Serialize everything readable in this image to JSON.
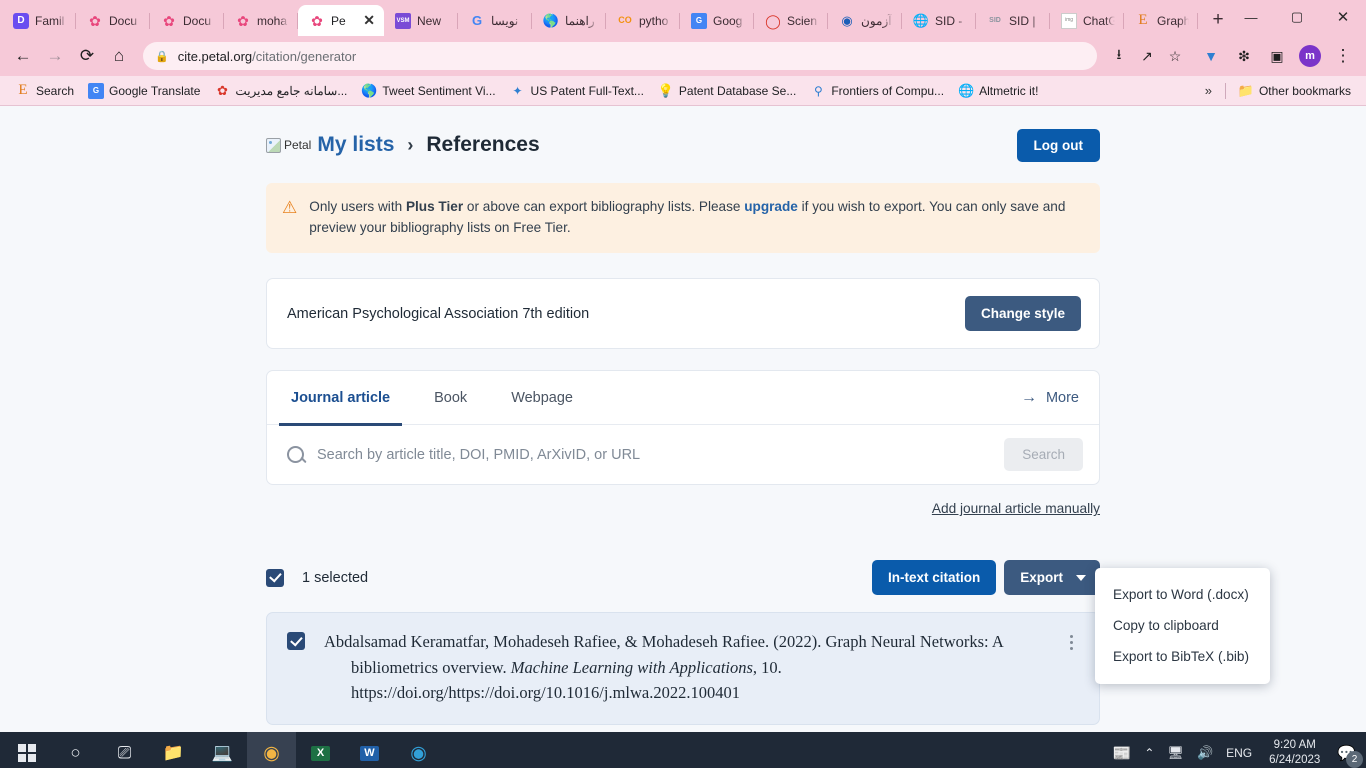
{
  "browser": {
    "tabs": [
      {
        "title": "Famil",
        "icon": "D",
        "icon_color": "#6a4df0",
        "active": false
      },
      {
        "title": "Docu",
        "icon": "flower",
        "icon_color": "#e8467c",
        "active": false
      },
      {
        "title": "Docu",
        "icon": "flower",
        "icon_color": "#e8467c",
        "active": false
      },
      {
        "title": "moha",
        "icon": "flower",
        "icon_color": "#e8467c",
        "active": false
      },
      {
        "title": "Pe",
        "icon": "flower",
        "icon_color": "#e8467c",
        "active": true
      },
      {
        "title": "New",
        "icon": "VSM",
        "icon_color": "#7a4bd6",
        "active": false
      },
      {
        "title": "نویسا",
        "icon": "G",
        "icon_color": "#4285f4",
        "active": false
      },
      {
        "title": "راهنما",
        "icon": "globe",
        "icon_color": "#2c3e50",
        "active": false
      },
      {
        "title": "pytho",
        "icon": "CO",
        "icon_color": "#f29111",
        "active": false
      },
      {
        "title": "Goog",
        "icon": "Gt",
        "icon_color": "#4285f4",
        "active": false
      },
      {
        "title": "Scien",
        "icon": "speech",
        "icon_color": "#d9372b",
        "active": false
      },
      {
        "title": "آزمون",
        "icon": "globe2",
        "icon_color": "#1a5eb8",
        "active": false
      },
      {
        "title": "SID -",
        "icon": "globe3",
        "icon_color": "#3a5566",
        "active": false
      },
      {
        "title": "SID |",
        "icon": "SID",
        "icon_color": "#8b949e",
        "active": false
      },
      {
        "title": "ChatG",
        "icon": "img",
        "icon_color": "#9aa0a6",
        "active": false
      },
      {
        "title": "Graph",
        "icon": "E",
        "icon_color": "#e07b1a",
        "active": false
      }
    ],
    "new_tab_label": "+",
    "tab_close_label": "✕",
    "window_controls": {
      "minimize": "—",
      "maximize": "▢",
      "close": "✕"
    },
    "nav": {
      "back": "←",
      "forward": "→",
      "reload": "⟳",
      "home": "⌂",
      "lock_icon": "🔒",
      "url_host": "cite.petal.org",
      "url_path": "/citation/generator",
      "install_icon": "install-icon",
      "share_icon": "share-icon",
      "bookmark_icon": "☆",
      "extension_icon": "puzzle-icon",
      "sidepanel_icon": "sidepanel-icon",
      "profile_initial": "m",
      "menu_icon": "⋮"
    },
    "bookmarks": [
      {
        "label": "Search",
        "icon": "E",
        "color": "#e07b1a"
      },
      {
        "label": "Google Translate",
        "icon": "Gt",
        "color": "#4285f4"
      },
      {
        "label": "سامانه جامع مدیریت...",
        "icon": "flower",
        "color": "#d9372b"
      },
      {
        "label": "Tweet Sentiment Vi...",
        "icon": "globe",
        "color": "#2c3e50"
      },
      {
        "label": "US Patent Full-Text...",
        "icon": "star",
        "color": "#2f7fd1"
      },
      {
        "label": "Patent Database Se...",
        "icon": "bulb",
        "color": "#e8c020"
      },
      {
        "label": "Frontiers of Compu...",
        "icon": "frontier",
        "color": "#2f7fd1"
      },
      {
        "label": "Altmetric it!",
        "icon": "circle",
        "color": "#2c3e50"
      }
    ],
    "bookmarks_overflow": "»",
    "other_bookmarks": {
      "label": "Other bookmarks",
      "icon": "folder-icon"
    }
  },
  "page": {
    "logo": {
      "alt": "Petal",
      "broken": true
    },
    "breadcrumb": {
      "parent": "My lists",
      "separator": "›",
      "current": "References"
    },
    "logout_label": "Log out",
    "warning": {
      "icon": "warning-triangle-icon",
      "part1": "Only users with ",
      "bold": "Plus Tier",
      "part2": " or above can export bibliography lists. Please ",
      "link": "upgrade",
      "part3": " if you wish to export. You can only save and preview your bibliography lists on Free Tier."
    },
    "style": {
      "name": "American Psychological Association 7th edition",
      "change_label": "Change style"
    },
    "source_tabs": [
      {
        "label": "Journal article",
        "active": true
      },
      {
        "label": "Book",
        "active": false
      },
      {
        "label": "Webpage",
        "active": false
      }
    ],
    "more_label": "More",
    "more_arrow": "→",
    "search": {
      "icon": "search-icon",
      "placeholder": "Search by article title, DOI, PMID, ArXivID, or URL",
      "value": "",
      "button_label": "Search"
    },
    "add_manually_label": "Add journal article manually",
    "selection": {
      "count_label": "1 selected",
      "checked": true,
      "intext_label": "In-text citation",
      "export_label": "Export"
    },
    "export_menu": {
      "open": true,
      "items": [
        "Export to Word (.docx)",
        "Copy to clipboard",
        "Export to BibTeX (.bib)"
      ]
    },
    "references": [
      {
        "checked": true,
        "authors": "Abdalsamad Keramatfar, Mohadeseh Rafiee, & Mohadeseh Rafiee.",
        "year": "(2022).",
        "title": "Graph Neural Networks: A bibliometrics overview.",
        "journal": "Machine Learning with Applications",
        "volume": ", 10.",
        "doi": "https://doi.org/https://doi.org/10.1016/j.mlwa.2022.100401",
        "menu_icon": "kebab-menu-icon"
      }
    ]
  },
  "taskbar": {
    "start_icon": "windows-start-icon",
    "search_icon": "○",
    "taskview_icon": "task-view-icon",
    "apps": [
      {
        "name": "file-explorer",
        "icon": "folder"
      },
      {
        "name": "remote-desktop",
        "icon": "monitor"
      },
      {
        "name": "google-chrome",
        "icon": "chrome",
        "active": true
      },
      {
        "name": "microsoft-excel",
        "icon": "X"
      },
      {
        "name": "microsoft-word",
        "icon": "W"
      },
      {
        "name": "microsoft-edge",
        "icon": "edge"
      }
    ],
    "tray": {
      "news_icon": "news-weather-icon",
      "chevron": "⌃",
      "network_icon": "network-icon",
      "volume_icon": "🔊",
      "language": "ENG",
      "time": "9:20 AM",
      "date": "6/24/2023",
      "notification_count": "2"
    }
  }
}
